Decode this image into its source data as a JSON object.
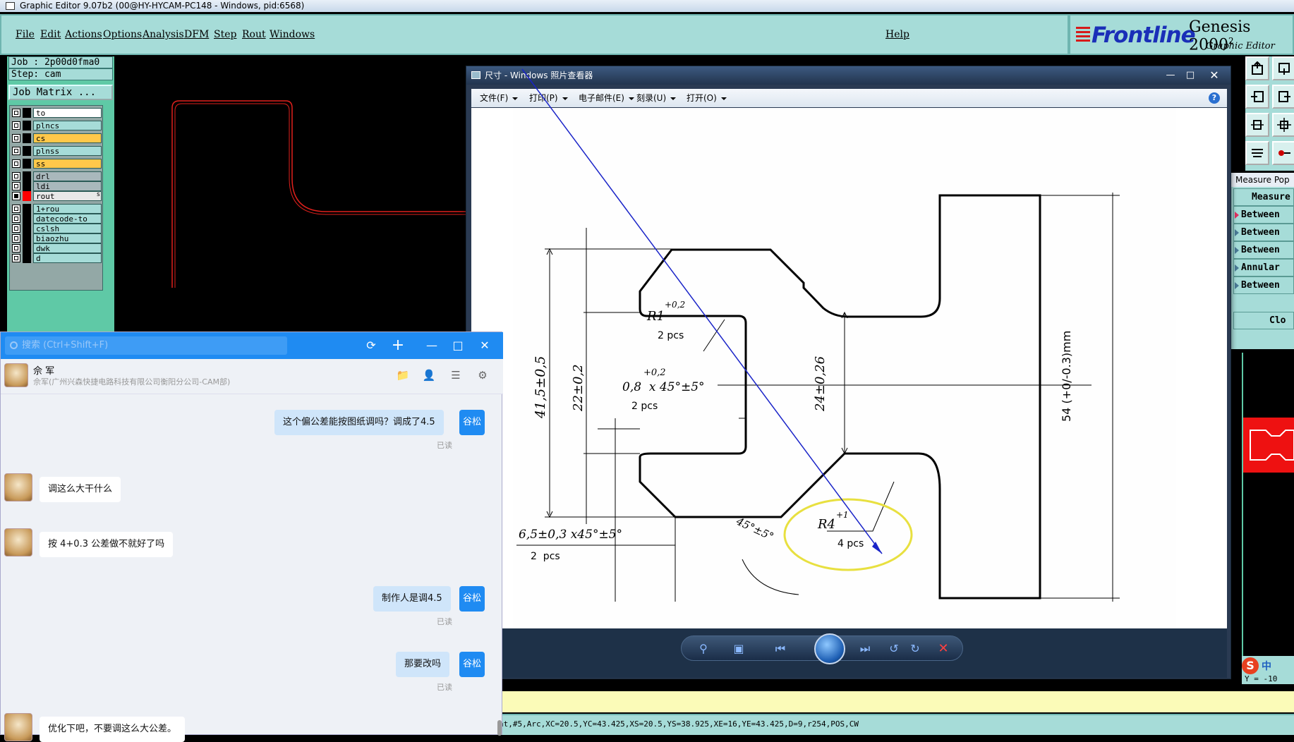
{
  "window_title": "Graphic Editor 9.07b2 (00@HY-HYCAM-PC148 - Windows, pid:6568)",
  "menu": [
    "File",
    "Edit",
    "Actions",
    "Options",
    "Analysis",
    "DFM",
    "Step",
    "Rout",
    "Windows"
  ],
  "help_label": "Help",
  "logo": {
    "brand": "Frontline",
    "product": "Genesis 2000",
    "sup": "2",
    "subtitle": "Graphic Editor"
  },
  "job": {
    "job": "Job : 2p00d0fma0",
    "step": "Step: cam",
    "matrix_btn": "Job Matrix ..."
  },
  "layers": [
    {
      "name": "to",
      "color": "#ffffff",
      "swatch": "#000000"
    },
    {
      "name": "plncs",
      "color": "#a6dcd8",
      "swatch": "#000000"
    },
    {
      "name": "cs",
      "color": "#ffc84a",
      "swatch": "#000000"
    },
    {
      "name": "plnss",
      "color": "#a6dcd8",
      "swatch": "#000000"
    },
    {
      "name": "ss",
      "color": "#ffc84a",
      "swatch": "#000000"
    },
    {
      "name": "drl",
      "color": "#a9b8bc",
      "swatch": "#000000"
    },
    {
      "name": "ldi",
      "color": "#a9b8bc",
      "swatch": "#000000"
    },
    {
      "name": "rout",
      "color": "#e8e8e8",
      "swatch": "#ff0000"
    },
    {
      "name": "1+rou",
      "color": "#a6dcd8",
      "swatch": "#000000"
    },
    {
      "name": "datecode-to",
      "color": "#a6dcd8",
      "swatch": "#000000"
    },
    {
      "name": "cslsh",
      "color": "#a6dcd8",
      "swatch": "#000000"
    },
    {
      "name": "biaozhu",
      "color": "#a6dcd8",
      "swatch": "#000000"
    },
    {
      "name": "dwk",
      "color": "#a6dcd8",
      "swatch": "#000000"
    },
    {
      "name": "d",
      "color": "#a6dcd8",
      "swatch": "#000000"
    }
  ],
  "rout_flag": "s",
  "measure": {
    "title": "Measure Pop",
    "rows": [
      "Measure",
      "Between",
      "Between",
      "Between",
      "Annular",
      "Between",
      "",
      "Clo"
    ]
  },
  "status_line": "nt,#5,Arc,XC=20.5,YC=43.425,XS=20.5,YS=38.925,XE=16,YE=43.425,D=9,r254,POS,CW",
  "coord_readout": "Y = -10",
  "ime": {
    "s": "S",
    "lang": "中"
  },
  "viewer": {
    "title": "尺寸 - Windows 照片查看器",
    "menu": [
      "文件(F)",
      "打印(P)",
      "电子邮件(E)",
      "刻录(U)",
      "打开(O)"
    ],
    "help": "?",
    "drawing_labels": {
      "r1": "R1",
      "r1_tol": "+0,2",
      "r1_pcs": "2 pcs",
      "chamfer_tol": "+0,2",
      "chamfer": "0,8  x 45°±5°",
      "chamfer_pcs": "2 pcs",
      "dim415": "41,5±0,5",
      "dim22": "22±0,2",
      "dim24": "24±0,26",
      "dim54": "54 (+0/-0.3)mm",
      "dim65": "6,5±0,3 x45°±5°",
      "dim65_pcs": "2  pcs",
      "ang45": "45°±5°",
      "r4": "R4",
      "r4_tol": "+1",
      "r4_pcs": "4 pcs"
    }
  },
  "chat": {
    "search_placeholder": "搜索 (Ctrl+Shift+F)",
    "contact_name": "佘 军",
    "contact_sub": "佘军(广州兴森快捷电路科技有限公司衡阳分公司-CAM部)",
    "messages": [
      {
        "from": "me",
        "text": "这个偏公差能按图纸调吗？调成了4.5",
        "read": "已读",
        "avatar": "谷松"
      },
      {
        "from": "them",
        "text": "调这么大干什么"
      },
      {
        "from": "them",
        "text": "按 4+0.3 公差做不就好了吗"
      },
      {
        "from": "me",
        "text": "制作人是调4.5",
        "read": "已读",
        "avatar": "谷松"
      },
      {
        "from": "me",
        "text": "那要改吗",
        "read": "已读",
        "avatar": "谷松"
      },
      {
        "from": "them",
        "text": "优化下吧，不要调这么大公差。"
      }
    ]
  }
}
